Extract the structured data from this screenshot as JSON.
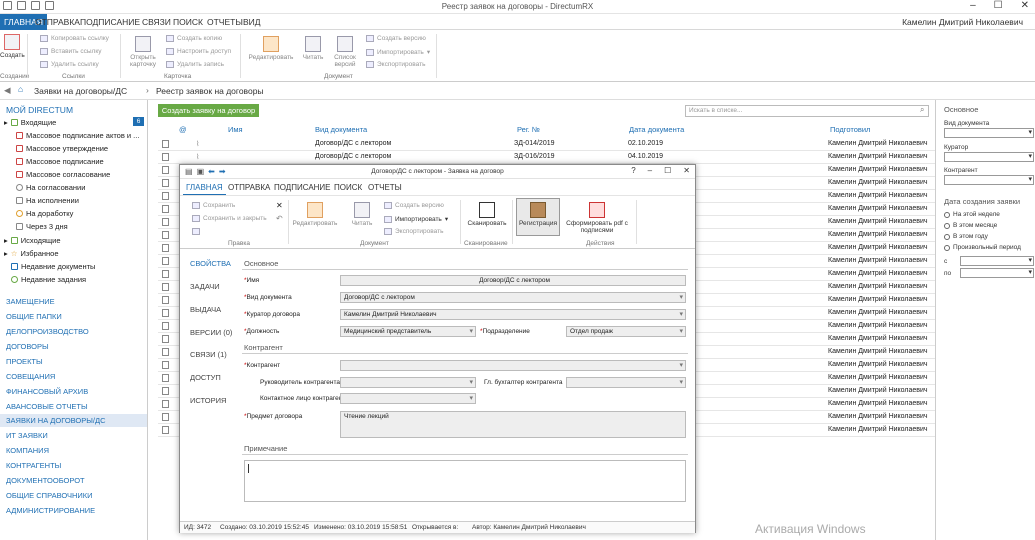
{
  "window": {
    "title": "Реестр заявок на договоры - DirectumRX",
    "user": "Камелин Дмитрий Николаевич"
  },
  "menu": [
    "ГЛАВНАЯ",
    "ОТПРАВКА",
    "ПОДПИСАНИЕ",
    "СВЯЗИ",
    "ПОИСК",
    "ОТЧЕТЫ",
    "ВИД"
  ],
  "ribbon": {
    "create": "Создать",
    "create_group": "Создание",
    "copy_link": "Копировать ссылку",
    "paste_link": "Вставить ссылку",
    "delete_link": "Удалить ссылку",
    "links_group": "Ссылки",
    "open_card": "Открыть карточку",
    "make_copy": "Создать копию",
    "setup_access": "Настроить доступ",
    "delete_record": "Удалить запись",
    "card_group": "Карточка",
    "edit": "Редактировать",
    "read": "Читать",
    "versions_list": "Список версий",
    "create_version": "Создать версию",
    "import": "Импортировать",
    "export": "Экспортировать",
    "document_group": "Документ"
  },
  "breadcrumb": [
    "Заявки на договоры/ДС",
    "Реестр заявок на договоры"
  ],
  "sidebar": {
    "my": "МОЙ DIRECTUM",
    "inbox": "Входящие",
    "inbox_count": "6",
    "inbox_items": [
      "Массовое подписание актов и ...",
      "Массовое утверждение",
      "Массовое подписание",
      "Массовое согласование",
      "На согласовании",
      "На исполнении",
      "На доработку",
      "Через 3 дня"
    ],
    "other": [
      "Исходящие",
      "Избранное",
      "Недавние документы",
      "Недавние задания"
    ],
    "sections": [
      "ЗАМЕЩЕНИЕ",
      "ОБЩИЕ ПАПКИ",
      "ДЕЛОПРОИЗВОДСТВО",
      "ДОГОВОРЫ",
      "ПРОЕКТЫ",
      "СОВЕЩАНИЯ",
      "ФИНАНСОВЫЙ АРХИВ",
      "АВАНСОВЫЕ ОТЧЕТЫ",
      "ЗАЯВКИ НА ДОГОВОРЫ/ДС",
      "ИТ ЗАЯВКИ",
      "КОМПАНИЯ",
      "КОНТРАГЕНТЫ",
      "ДОКУМЕНТООБОРОТ",
      "ОБЩИЕ СПРАВОЧНИКИ",
      "АДМИНИСТРИРОВАНИЕ"
    ]
  },
  "list": {
    "new_button": "Создать заявку на договор",
    "search_placeholder": "Искать в списке...",
    "columns": [
      "@",
      "Имя",
      "Вид документа",
      "Рег. №",
      "Дата документа",
      "Подготовил"
    ],
    "rows": [
      {
        "kind": "Договор/ДС с лектором",
        "reg": "ЗД-014/2019",
        "date": "02.10.2019",
        "author": "Камелин Дмитрий Николаевич"
      },
      {
        "kind": "Договор/ДС с лектором",
        "reg": "ЗД-016/2019",
        "date": "04.10.2019",
        "author": "Камелин Дмитрий Николаевич"
      }
    ],
    "author_repeat": "Камелин Дмитрий Николаевич"
  },
  "filter": {
    "title": "Основное",
    "doc_kind": "Вид документа",
    "curator": "Куратор",
    "counterparty": "Контрагент",
    "date_title": "Дата создания заявки",
    "periods": [
      "На этой неделе",
      "В этом месяце",
      "В этом году",
      "Произвольный период"
    ],
    "from": "с",
    "to": "по"
  },
  "dialog": {
    "title": "Договор/ДС с лектором - Заявка на договор",
    "menu": [
      "ГЛАВНАЯ",
      "ОТПРАВКА",
      "ПОДПИСАНИЕ",
      "ПОИСК",
      "ОТЧЕТЫ"
    ],
    "save": "Сохранить",
    "save_close": "Сохранить и закрыть",
    "rights_group": "Правка",
    "edit": "Редактировать",
    "read": "Читать",
    "create_version": "Создать версию",
    "import": "Импортировать",
    "export": "Экспортировать",
    "document_group": "Документ",
    "scan": "Сканировать",
    "scan_group": "Сканирование",
    "registration": "Регистрация",
    "form_pdf": "Сформировать pdf с подписями",
    "actions_group": "Действия",
    "tabs": [
      "СВОЙСТВА",
      "ЗАДАЧИ",
      "ВЫДАЧА",
      "ВЕРСИИ (0)",
      "СВЯЗИ (1)",
      "ДОСТУП",
      "ИСТОРИЯ"
    ],
    "main_section": "Основное",
    "name_label": "Имя",
    "name_value": "Договор/ДС с лектором",
    "kind_label": "Вид документа",
    "kind_value": "Договор/ДС с лектором",
    "curator_label": "Куратор договора",
    "curator_value": "Камелин Дмитрий Николаевич",
    "position_label": "Должность",
    "position_value": "Медицинский представитель",
    "dept_label": "Подразделение",
    "dept_value": "Отдел продаж",
    "counterparty_section": "Контрагент",
    "cp_label": "Контрагент",
    "head_label": "Руководитель контрагента",
    "accountant_label": "Гл. бухгалтер контрагента",
    "contact_label": "Контактное лицо контрагента",
    "subject_label": "Предмет договора",
    "subject_value": "Чтение лекций",
    "note_section": "Примечание",
    "status": {
      "id": "ИД: 3472",
      "created": "Создано: 03.10.2019 15:52:45",
      "modified": "Изменено: 03.10.2019 15:58:51",
      "opened": "Открывается в:",
      "author": "Автор: Камелин Дмитрий Николаевич"
    }
  },
  "watermark": "Активация Windows"
}
